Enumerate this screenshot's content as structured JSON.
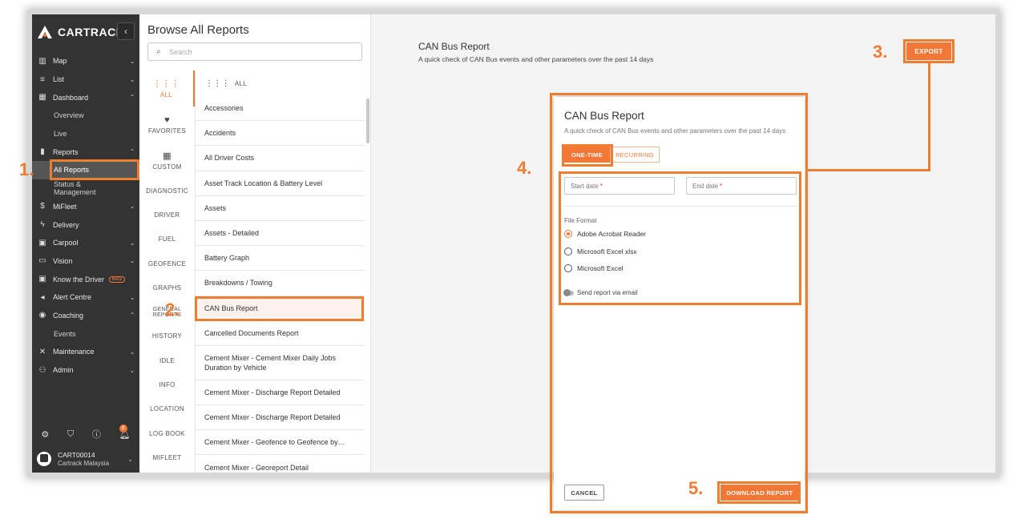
{
  "app": {
    "brand": "CARTRACK",
    "collapse_icon": "chevron-left-icon"
  },
  "sidebar": {
    "items": [
      {
        "label": "Map",
        "icon": "map-icon",
        "glyph": "▥",
        "chevron": "⌄",
        "sub": false,
        "active": false
      },
      {
        "label": "List",
        "icon": "list-icon",
        "glyph": "≡",
        "chevron": "⌄",
        "sub": false,
        "active": false
      },
      {
        "label": "Dashboard",
        "icon": "dashboard-icon",
        "glyph": "▦",
        "chevron": "⌃",
        "sub": false,
        "active": false
      },
      {
        "label": "Overview",
        "icon": "",
        "glyph": "",
        "chevron": "",
        "sub": true,
        "active": false
      },
      {
        "label": "Live",
        "icon": "",
        "glyph": "",
        "chevron": "",
        "sub": true,
        "active": false
      },
      {
        "label": "Reports",
        "icon": "reports-icon",
        "glyph": "▮",
        "chevron": "⌃",
        "sub": false,
        "active": false
      },
      {
        "label": "All Reports",
        "icon": "",
        "glyph": "",
        "chevron": "",
        "sub": true,
        "active": true
      },
      {
        "label": "Status & Management",
        "icon": "",
        "glyph": "",
        "chevron": "",
        "sub": true,
        "active": false
      },
      {
        "label": "MiFleet",
        "icon": "dollar-icon",
        "glyph": "$",
        "chevron": "⌄",
        "sub": false,
        "active": false
      },
      {
        "label": "Delivery",
        "icon": "bolt-icon",
        "glyph": "ϟ",
        "chevron": "",
        "sub": false,
        "active": false
      },
      {
        "label": "Carpool",
        "icon": "calendar-icon",
        "glyph": "▣",
        "chevron": "⌄",
        "sub": false,
        "active": false
      },
      {
        "label": "Vision",
        "icon": "camera-icon",
        "glyph": "▭",
        "chevron": "⌄",
        "sub": false,
        "active": false
      },
      {
        "label": "Know the Driver",
        "icon": "driver-badge-icon",
        "glyph": "▣",
        "chevron": "",
        "sub": false,
        "active": false,
        "badge": "Beta"
      },
      {
        "label": "Alert Centre",
        "icon": "megaphone-icon",
        "glyph": "◂",
        "chevron": "⌄",
        "sub": false,
        "active": false
      },
      {
        "label": "Coaching",
        "icon": "coaching-icon",
        "glyph": "◉",
        "chevron": "⌃",
        "sub": false,
        "active": false
      },
      {
        "label": "Events",
        "icon": "",
        "glyph": "",
        "chevron": "",
        "sub": true,
        "active": false
      },
      {
        "label": "Maintenance",
        "icon": "tools-icon",
        "glyph": "✕",
        "chevron": "⌄",
        "sub": false,
        "active": false
      },
      {
        "label": "Admin",
        "icon": "admin-icon",
        "glyph": "⚇",
        "chevron": "⌄",
        "sub": false,
        "active": false
      }
    ],
    "bottom_icons": [
      "settings-icon",
      "shield-icon",
      "help-icon",
      "bell-icon"
    ],
    "notification_count": "8",
    "user": {
      "name": "CART00014",
      "company": "Cartrack Malaysia"
    }
  },
  "browse": {
    "title": "Browse All Reports",
    "search_placeholder": "Search",
    "categories": [
      {
        "label": "ALL",
        "icon": "grid-icon",
        "glyph": "⋮⋮⋮",
        "active": true
      },
      {
        "label": "FAVORITES",
        "icon": "heart-icon",
        "glyph": "♥",
        "active": false
      },
      {
        "label": "CUSTOM",
        "icon": "custom-grid-icon",
        "glyph": "▦",
        "active": false
      },
      {
        "label": "DIAGNOSTIC",
        "icon": "",
        "glyph": "",
        "active": false
      },
      {
        "label": "DRIVER",
        "icon": "",
        "glyph": "",
        "active": false
      },
      {
        "label": "FUEL",
        "icon": "",
        "glyph": "",
        "active": false
      },
      {
        "label": "GEOFENCE",
        "icon": "",
        "glyph": "",
        "active": false
      },
      {
        "label": "GRAPHS",
        "icon": "",
        "glyph": "",
        "active": false
      },
      {
        "label": "GENERAL REPORTS",
        "icon": "",
        "glyph": "",
        "active": false
      },
      {
        "label": "HISTORY",
        "icon": "",
        "glyph": "",
        "active": false
      },
      {
        "label": "IDLE",
        "icon": "",
        "glyph": "",
        "active": false
      },
      {
        "label": "INFO",
        "icon": "",
        "glyph": "",
        "active": false
      },
      {
        "label": "LOCATION",
        "icon": "",
        "glyph": "",
        "active": false
      },
      {
        "label": "LOG BOOK",
        "icon": "",
        "glyph": "",
        "active": false
      },
      {
        "label": "MIFLEET",
        "icon": "",
        "glyph": "",
        "active": false
      }
    ],
    "list_header": "ALL",
    "reports": [
      "Accessories",
      "Accidents",
      "All Driver Costs",
      "Asset Track Location & Battery Level",
      "Assets",
      "Assets - Detailed",
      "Battery Graph",
      "Breakdowns / Towing",
      "CAN Bus Report",
      "Cancelled Documents Report",
      "Cement Mixer - Cement Mixer Daily Jobs Duration by Vehicle",
      "Cement Mixer - Discharge Report Detailed",
      "Cement Mixer - Discharge Report Detailed",
      "Cement Mixer - Geofence to Geofence by…",
      "Cement Mixer - Georeport Detail"
    ],
    "selected_report": "CAN Bus Report"
  },
  "main": {
    "title": "CAN Bus Report",
    "description": "A quick check of CAN Bus events and other parameters over the past 14 days",
    "export_label": "EXPORT"
  },
  "modal": {
    "title": "CAN Bus Report",
    "description": "A quick check of CAN Bus events and other parameters over the past 14 days",
    "tab_one_time": "ONE-TIME",
    "tab_recurring": "RECURRING",
    "start_date_label": "Start date",
    "end_date_label": "End date",
    "required_mark": "*",
    "file_format_label": "File Format",
    "formats": [
      "Adobe Acrobat Reader",
      "Microsoft Excel xlsx",
      "Microsoft Excel"
    ],
    "selected_format": "Adobe Acrobat Reader",
    "send_email_label": "Send report via email",
    "cancel_label": "CANCEL",
    "download_label": "DOWNLOAD REPORT"
  },
  "annotations": {
    "step1": "1.",
    "step2": "2.",
    "step3": "3.",
    "step4": "4.",
    "step5": "5."
  },
  "colors": {
    "accent": "#f47735",
    "annotation": "#ed7d31",
    "sidebar_bg": "#333333"
  }
}
